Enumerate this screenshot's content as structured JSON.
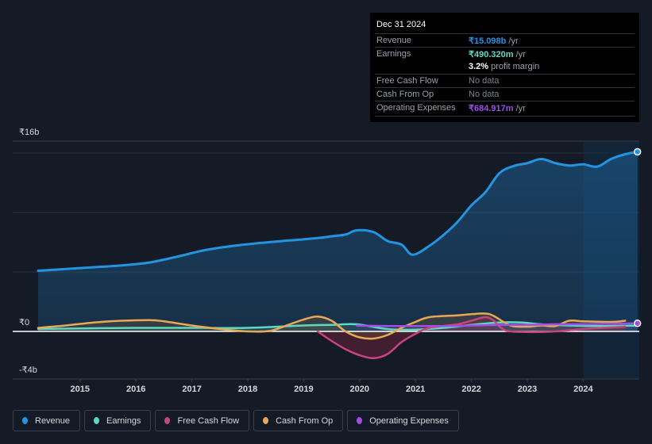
{
  "tooltip": {
    "date": "Dec 31 2024",
    "rows": [
      {
        "label": "Revenue",
        "value": "₹15.098b",
        "suffix": " /yr",
        "color": "#2394e0"
      },
      {
        "label": "Earnings",
        "value": "₹490.320m",
        "suffix": " /yr",
        "color": "#5ed8c0"
      },
      {
        "label": "",
        "value": "3.2%",
        "suffix": " profit margin",
        "color": "#ffffff"
      },
      {
        "label": "Free Cash Flow",
        "value": "",
        "suffix": "No data",
        "color": "#7d838c"
      },
      {
        "label": "Cash From Op",
        "value": "",
        "suffix": "No data",
        "color": "#7d838c"
      },
      {
        "label": "Operating Expenses",
        "value": "₹684.917m",
        "suffix": " /yr",
        "color": "#a04ee8"
      }
    ]
  },
  "legend": [
    {
      "label": "Revenue",
      "color": "#2394e0"
    },
    {
      "label": "Earnings",
      "color": "#5ed8c0"
    },
    {
      "label": "Free Cash Flow",
      "color": "#c8447f"
    },
    {
      "label": "Cash From Op",
      "color": "#e8a857"
    },
    {
      "label": "Operating Expenses",
      "color": "#a04ee8"
    }
  ],
  "chart_data": {
    "type": "area",
    "title": "",
    "xlabel": "",
    "ylabel": "",
    "ylim": [
      -4,
      16
    ],
    "y_unit": "₹ billions",
    "y_ticks": [
      {
        "value": 16,
        "label": "₹16b"
      },
      {
        "value": 0,
        "label": "₹0"
      },
      {
        "value": -4,
        "label": "-₹4b"
      }
    ],
    "gridlines": [
      15,
      10,
      5
    ],
    "x_ticks": [
      "2015",
      "2016",
      "2017",
      "2018",
      "2019",
      "2020",
      "2021",
      "2022",
      "2023",
      "2024"
    ],
    "xlim": [
      2014.0,
      2025.05
    ],
    "highlight_from": 2024.0,
    "legend_position": "bottom-left",
    "series": [
      {
        "name": "Revenue",
        "color": "#2394e0",
        "points": [
          [
            2014.25,
            5.1
          ],
          [
            2014.75,
            5.25
          ],
          [
            2015.25,
            5.4
          ],
          [
            2015.75,
            5.55
          ],
          [
            2016.25,
            5.8
          ],
          [
            2016.75,
            6.3
          ],
          [
            2017.25,
            6.85
          ],
          [
            2017.75,
            7.2
          ],
          [
            2018.25,
            7.45
          ],
          [
            2018.75,
            7.65
          ],
          [
            2019.25,
            7.85
          ],
          [
            2019.5,
            8.0
          ],
          [
            2019.75,
            8.15
          ],
          [
            2019.95,
            8.5
          ],
          [
            2020.25,
            8.35
          ],
          [
            2020.5,
            7.6
          ],
          [
            2020.75,
            7.3
          ],
          [
            2020.95,
            6.45
          ],
          [
            2021.25,
            7.2
          ],
          [
            2021.5,
            8.1
          ],
          [
            2021.75,
            9.2
          ],
          [
            2022.0,
            10.6
          ],
          [
            2022.25,
            11.7
          ],
          [
            2022.5,
            13.3
          ],
          [
            2022.75,
            13.9
          ],
          [
            2023.0,
            14.15
          ],
          [
            2023.25,
            14.5
          ],
          [
            2023.5,
            14.15
          ],
          [
            2023.75,
            13.95
          ],
          [
            2024.0,
            14.05
          ],
          [
            2024.25,
            13.85
          ],
          [
            2024.5,
            14.5
          ],
          [
            2024.75,
            14.9
          ],
          [
            2024.97,
            15.1
          ]
        ]
      },
      {
        "name": "Earnings",
        "color": "#5ed8c0",
        "points": [
          [
            2014.25,
            0.2
          ],
          [
            2015.0,
            0.25
          ],
          [
            2016.0,
            0.3
          ],
          [
            2017.0,
            0.3
          ],
          [
            2018.0,
            0.3
          ],
          [
            2019.0,
            0.5
          ],
          [
            2019.5,
            0.55
          ],
          [
            2019.95,
            0.6
          ],
          [
            2020.5,
            0.2
          ],
          [
            2021.0,
            0.15
          ],
          [
            2021.5,
            0.3
          ],
          [
            2022.0,
            0.55
          ],
          [
            2022.5,
            0.75
          ],
          [
            2022.9,
            0.75
          ],
          [
            2023.25,
            0.6
          ],
          [
            2023.75,
            0.5
          ],
          [
            2024.25,
            0.45
          ],
          [
            2024.97,
            0.49
          ]
        ]
      },
      {
        "name": "Free Cash Flow",
        "color": "#c8447f",
        "points": [
          [
            2019.25,
            0.0
          ],
          [
            2019.5,
            -0.8
          ],
          [
            2019.75,
            -1.5
          ],
          [
            2020.0,
            -2.0
          ],
          [
            2020.25,
            -2.25
          ],
          [
            2020.5,
            -1.9
          ],
          [
            2020.75,
            -0.9
          ],
          [
            2021.0,
            -0.2
          ],
          [
            2021.25,
            0.3
          ],
          [
            2021.75,
            0.6
          ],
          [
            2022.0,
            0.9
          ],
          [
            2022.25,
            1.2
          ],
          [
            2022.4,
            0.9
          ],
          [
            2022.6,
            0.1
          ],
          [
            2023.0,
            -0.05
          ],
          [
            2023.5,
            0.0
          ],
          [
            2024.0,
            0.2
          ],
          [
            2024.75,
            0.4
          ]
        ]
      },
      {
        "name": "Cash From Op",
        "color": "#e8a857",
        "points": [
          [
            2014.25,
            0.3
          ],
          [
            2014.75,
            0.5
          ],
          [
            2015.25,
            0.75
          ],
          [
            2015.75,
            0.9
          ],
          [
            2016.25,
            0.95
          ],
          [
            2016.5,
            0.85
          ],
          [
            2017.0,
            0.5
          ],
          [
            2017.5,
            0.2
          ],
          [
            2018.0,
            0.0
          ],
          [
            2018.4,
            0.05
          ],
          [
            2018.75,
            0.6
          ],
          [
            2019.0,
            1.0
          ],
          [
            2019.25,
            1.25
          ],
          [
            2019.5,
            0.9
          ],
          [
            2019.75,
            0.0
          ],
          [
            2020.0,
            -0.5
          ],
          [
            2020.25,
            -0.6
          ],
          [
            2020.5,
            -0.3
          ],
          [
            2020.75,
            0.3
          ],
          [
            2021.0,
            0.8
          ],
          [
            2021.25,
            1.2
          ],
          [
            2021.75,
            1.35
          ],
          [
            2022.0,
            1.45
          ],
          [
            2022.25,
            1.5
          ],
          [
            2022.4,
            1.3
          ],
          [
            2022.7,
            0.5
          ],
          [
            2023.0,
            0.4
          ],
          [
            2023.25,
            0.5
          ],
          [
            2023.5,
            0.45
          ],
          [
            2023.75,
            0.9
          ],
          [
            2024.0,
            0.85
          ],
          [
            2024.5,
            0.8
          ],
          [
            2024.75,
            0.9
          ]
        ]
      },
      {
        "name": "Operating Expenses",
        "color": "#a04ee8",
        "points": [
          [
            2019.95,
            0.5
          ],
          [
            2020.5,
            0.45
          ],
          [
            2021.0,
            0.45
          ],
          [
            2021.5,
            0.45
          ],
          [
            2022.0,
            0.5
          ],
          [
            2022.5,
            0.55
          ],
          [
            2023.0,
            0.55
          ],
          [
            2023.5,
            0.6
          ],
          [
            2024.0,
            0.6
          ],
          [
            2024.5,
            0.65
          ],
          [
            2024.97,
            0.68
          ]
        ]
      }
    ]
  }
}
